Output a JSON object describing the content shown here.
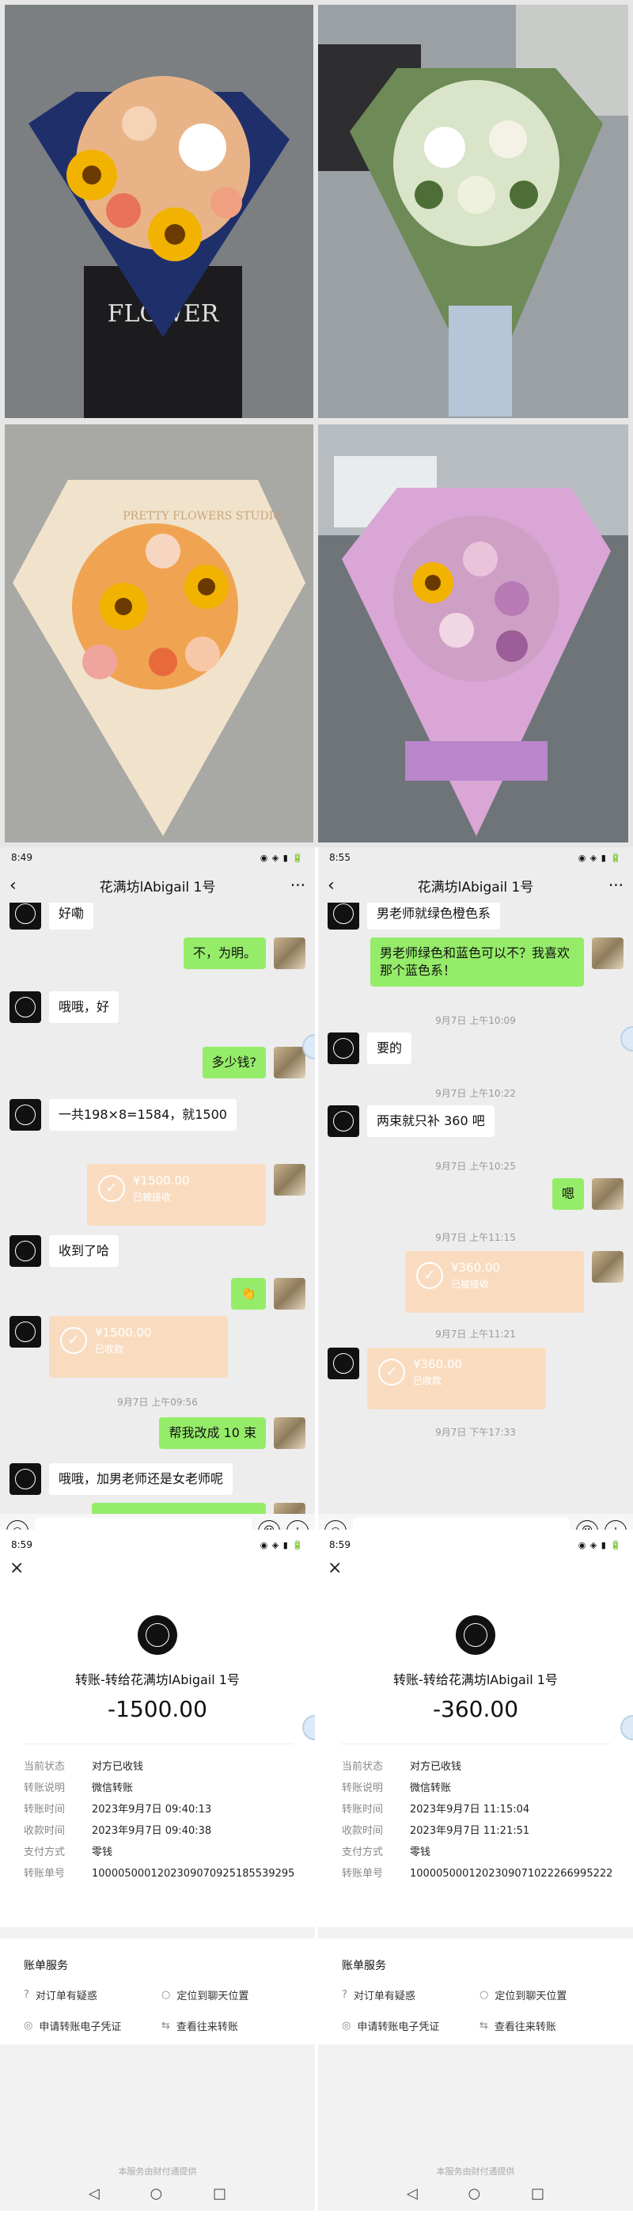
{
  "chat_left": {
    "status_time": "8:49",
    "title": "花满坊lAbigail 1号",
    "messages": [
      "好嘞",
      "不，为明。",
      "哦哦，好",
      "多少钱?",
      "一共198×8=1584，就1500",
      "收到了哈",
      "帮我改成 10 束",
      "哦哦，加男老师还是女老师呢"
    ],
    "transfer_sent": {
      "amount": "¥1500.00",
      "status": "已被接收"
    },
    "transfer_recv": {
      "amount": "¥1500.00",
      "status": "已收款"
    },
    "timestamp": "9月7日 上午09:56"
  },
  "chat_right": {
    "status_time": "8:55",
    "title": "花满坊lAbigail 1号",
    "messages": [
      "男老师就绿色橙色系",
      "男老师绿色和蓝色可以不？我喜欢那个蓝色系！",
      "要的",
      "两束就只补 360 吧",
      "嗯"
    ],
    "timestamps": [
      "9月7日 上午10:09",
      "9月7日 上午10:22",
      "9月7日 上午10:25",
      "9月7日 上午11:15",
      "9月7日 上午11:21",
      "9月7日 下午17:33"
    ],
    "transfer_sent": {
      "amount": "¥360.00",
      "status": "已被接收"
    },
    "transfer_recv": {
      "amount": "¥360.00",
      "status": "已收款"
    }
  },
  "detail_left": {
    "status_time": "8:59",
    "title": "转账-转给花满坊lAbigail 1号",
    "amount": "-1500.00",
    "labels": [
      "当前状态",
      "转账说明",
      "转账时间",
      "收款时间",
      "支付方式",
      "转账单号"
    ],
    "values": [
      "对方已收钱",
      "微信转账",
      "2023年9月7日 09:40:13",
      "2023年9月7日 09:40:38",
      "零钱",
      "1000050001202309070925185539295"
    ]
  },
  "detail_right": {
    "status_time": "8:59",
    "title": "转账-转给花满坊lAbigail 1号",
    "amount": "-360.00",
    "labels": [
      "当前状态",
      "转账说明",
      "转账时间",
      "收款时间",
      "支付方式",
      "转账单号"
    ],
    "values": [
      "对方已收钱",
      "微信转账",
      "2023年9月7日 11:15:04",
      "2023年9月7日 11:21:51",
      "零钱",
      "1000050001202309071022266995222"
    ]
  },
  "service": {
    "title": "账单服务",
    "items": [
      "对订单有疑惑",
      "定位到聊天位置",
      "申请转账电子凭证",
      "查看往来转账"
    ],
    "footer": "本服务由财付通提供"
  },
  "photo_text": {
    "box": "FLOWER",
    "wrap": "PRETTY FLOWERS STUDIO"
  }
}
